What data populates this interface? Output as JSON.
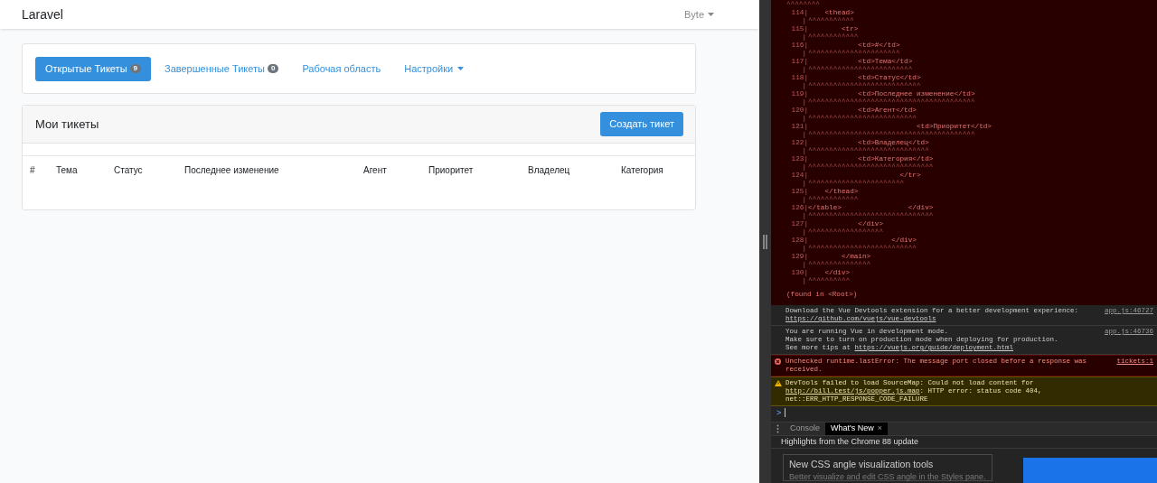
{
  "navbar": {
    "brand": "Laravel",
    "user": "Byte"
  },
  "nav_tabs": [
    {
      "label": "Открытые Тикеты",
      "badge": "9",
      "selected": true,
      "kind": "tab"
    },
    {
      "label": "Завершенные Тикеты",
      "badge": "0",
      "selected": false,
      "kind": "tab"
    },
    {
      "label": "Рабочая область",
      "selected": false,
      "kind": "tab"
    },
    {
      "label": "Настройки",
      "selected": false,
      "kind": "dropdown"
    }
  ],
  "panel": {
    "title": "Мои тикеты",
    "button": "Создать тикет",
    "columns": [
      "#",
      "Тема",
      "Статус",
      "Последнее изменение",
      "Агент",
      "Приоритет",
      "Владелец",
      "Категория"
    ]
  },
  "devtools": {
    "top_carets": "^^^^^^^^",
    "source_lines": [
      {
        "number": "114|",
        "gutter": "|",
        "code": "    <thead>",
        "carets": "^^^^^^^^^^^"
      },
      {
        "number": "115|",
        "gutter": "|",
        "code": "        <tr>",
        "carets": "^^^^^^^^^^^^"
      },
      {
        "number": "116|",
        "gutter": "|",
        "code": "            <td>#</td>",
        "carets": "^^^^^^^^^^^^^^^^^^^^^^"
      },
      {
        "number": "117|",
        "gutter": "|",
        "code": "            <td>Тема</td>",
        "carets": "^^^^^^^^^^^^^^^^^^^^^^^^^"
      },
      {
        "number": "118|",
        "gutter": "|",
        "code": "            <td>Статус</td>",
        "carets": "^^^^^^^^^^^^^^^^^^^^^^^^^^^"
      },
      {
        "number": "119|",
        "gutter": "|",
        "code": "            <td>Последнее изменение</td>",
        "carets": "^^^^^^^^^^^^^^^^^^^^^^^^^^^^^^^^^^^^^^^^"
      },
      {
        "number": "120|",
        "gutter": "|",
        "code": "            <td>Агент</td>",
        "carets": "^^^^^^^^^^^^^^^^^^^^^^^^^^"
      },
      {
        "number": "121|",
        "gutter": "|",
        "code": "                          <td>Приоритет</td>",
        "carets": "^^^^^^^^^^^^^^^^^^^^^^^^^^^^^^^^^^^^^^^^"
      },
      {
        "number": "122|",
        "gutter": "|",
        "code": "            <td>Владелец</td>",
        "carets": "^^^^^^^^^^^^^^^^^^^^^^^^^^^^^"
      },
      {
        "number": "123|",
        "gutter": "|",
        "code": "            <td>Категория</td>",
        "carets": "^^^^^^^^^^^^^^^^^^^^^^^^^^^^^^"
      },
      {
        "number": "124|",
        "gutter": "|",
        "code": "                      </tr>",
        "carets": "^^^^^^^^^^^^^^^^^^^^^^^"
      },
      {
        "number": "125|",
        "gutter": "|",
        "code": "    </thead>",
        "carets": "^^^^^^^^^^^^"
      },
      {
        "number": "126|",
        "gutter": "|",
        "code": "</table>                </div>",
        "carets": "^^^^^^^^^^^^^^^^^^^^^^^^^^^^^^"
      },
      {
        "number": "127|",
        "gutter": "|",
        "code": "            </div>",
        "carets": "^^^^^^^^^^^^^^^^^^"
      },
      {
        "number": "128|",
        "gutter": "|",
        "code": "                    </div>",
        "carets": "^^^^^^^^^^^^^^^^^^^^^^^^^^"
      },
      {
        "number": "129|",
        "gutter": "|",
        "code": "        </main>",
        "carets": "^^^^^^^^^^^^^^^"
      },
      {
        "number": "130|",
        "gutter": "|",
        "code": "    </div>",
        "carets": "^^^^^^^^^^"
      }
    ],
    "found_in": "(found in <Root>)",
    "messages": [
      {
        "kind": "info",
        "source": "app.js:46727",
        "lines": [
          {
            "text": "Download the Vue Devtools extension for a better development experience:"
          },
          {
            "link": "https://github.com/vuejs/vue-devtools"
          }
        ]
      },
      {
        "kind": "info",
        "source": "app.js:46736",
        "lines": [
          {
            "text": "You are running Vue in development mode."
          },
          {
            "text": "Make sure to turn on production mode when deploying for production."
          },
          {
            "text": "See more tips at ",
            "link": "https://vuejs.org/guide/deployment.html"
          }
        ]
      },
      {
        "kind": "error",
        "source": "tickets:1",
        "lines": [
          {
            "text": "Unchecked runtime.lastError: The message port closed before a response was received."
          }
        ]
      },
      {
        "kind": "warning",
        "lines": [
          {
            "text": "DevTools failed to load SourceMap: Could not load content for ",
            "link": "http://bill.test/js/popper.js.map",
            "after": ": HTTP error: status code 404, net::ERR_HTTP_RESPONSE_CODE_FAILURE"
          }
        ]
      }
    ],
    "prompt": ">",
    "drawer": {
      "tabs": [
        {
          "label": "Console",
          "selected": false,
          "closable": false
        },
        {
          "label": "What's New",
          "selected": true,
          "closable": true
        }
      ],
      "close": "×",
      "heading": "Highlights from the Chrome 88 update",
      "card": {
        "title": "New CSS angle visualization tools",
        "description": "Better visualize and edit CSS angle in the Styles pane."
      }
    }
  }
}
